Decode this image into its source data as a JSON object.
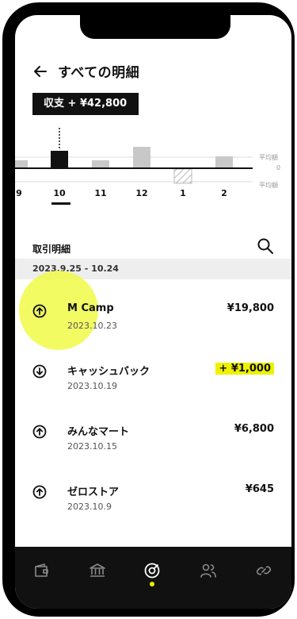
{
  "header": {
    "title": "すべての明細"
  },
  "chart": {
    "tooltip": "収支 + ¥42,800",
    "ref_labels": {
      "avg_top": "平均額",
      "zero": "0",
      "avg_bottom": "平均額"
    }
  },
  "chart_data": {
    "type": "bar",
    "categories": [
      "9",
      "10",
      "11",
      "12",
      "1",
      "2"
    ],
    "selected": "10",
    "values": [
      10,
      22,
      10,
      27,
      -18,
      15
    ],
    "annotations": [
      "収支 + ¥42,800"
    ]
  },
  "list": {
    "section_title": "取引明細",
    "date_range": "2023.9.25 - 10.24",
    "transactions": [
      {
        "name": "M Camp",
        "date": "2023.10.23",
        "amount": "¥19,800",
        "direction": "out"
      },
      {
        "name": "キャッシュバック",
        "date": "2023.10.19",
        "amount": "+ ¥1,000",
        "direction": "in"
      },
      {
        "name": "みんなマート",
        "date": "2023.10.15",
        "amount": "¥6,800",
        "direction": "out"
      },
      {
        "name": "ゼロストア",
        "date": "2023.10.9",
        "amount": "¥645",
        "direction": "out"
      }
    ]
  },
  "nav": {
    "items": [
      "wallet-icon",
      "bank-icon",
      "activity-icon",
      "people-icon",
      "link-icon"
    ],
    "active": "activity-icon",
    "colors": {
      "background": "#111111",
      "accent": "#e9f200"
    }
  }
}
